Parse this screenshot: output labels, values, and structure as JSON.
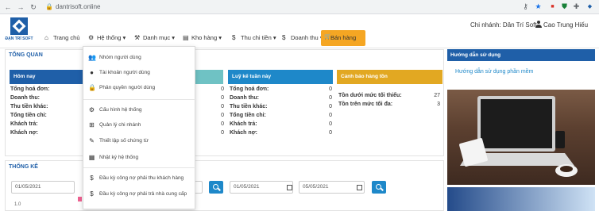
{
  "browser": {
    "url": "dantrisoft.online"
  },
  "logo": {
    "text": "ĐẠN TRÍ SOFT"
  },
  "header": {
    "branch_label": "Chi nhánh: Dân Trí Soft",
    "user_name": "Cao Trung Hiếu"
  },
  "menu": [
    {
      "label": "Trang chủ",
      "icon": "home-icon"
    },
    {
      "label": "Hệ thống",
      "icon": "gear-icon"
    },
    {
      "label": "Danh mục",
      "icon": "wrench-icon"
    },
    {
      "label": "Kho hàng",
      "icon": "warehouse-icon"
    },
    {
      "label": "Thu chi tiền",
      "icon": "dollar-icon"
    },
    {
      "label": "Doanh thu",
      "icon": "dollar-icon"
    },
    {
      "label": "Bán hàng",
      "icon": "cart-icon"
    }
  ],
  "overview": {
    "title": "TỔNG QUAN"
  },
  "cards": {
    "today": {
      "title": "Hôm nay",
      "rows": [
        "Tổng hoá đơn:",
        "Doanh thu:",
        "Thu tiền khác:",
        "Tổng tiền chi:",
        "Khách trả:",
        "Khách nợ:"
      ]
    },
    "middle": {
      "values": [
        "0",
        "0",
        "0",
        "0",
        "0",
        "0"
      ]
    },
    "weekly": {
      "title": "Luỹ kế tuần này",
      "rows": [
        "Tổng hoá đơn:",
        "Doanh thu:",
        "Thu tiền khác:",
        "Tổng tiền chi:",
        "Khách trả:",
        "Khách nợ:"
      ],
      "values": [
        "0",
        "0",
        "0",
        "0",
        "0",
        "0"
      ]
    },
    "stock": {
      "title": "Cảnh báo hàng tồn",
      "rows": [
        "Tồn dưới mức tối thiểu:",
        "Tồn trên mức tối đa:"
      ],
      "values": [
        "27",
        "3"
      ]
    }
  },
  "stats": {
    "title": "THỐNG KÊ",
    "date_from_1": "01/05/2021",
    "date_from_2": "01/05/2021",
    "date_to_2": "05/05/2021",
    "axis_value": "1.0"
  },
  "dropdown": {
    "items": [
      {
        "label": "Nhóm người dùng",
        "icon": "users-icon"
      },
      {
        "label": "Tài khoản người dùng",
        "icon": "user-icon"
      },
      {
        "label": "Phân quyền người dùng",
        "icon": "lock-icon"
      },
      {
        "label": "Cấu hình hệ thống",
        "icon": "cogs-icon"
      },
      {
        "label": "Quản lý chi nhánh",
        "icon": "sitemap-icon"
      },
      {
        "label": "Thiết lập số chứng từ",
        "icon": "edit-icon"
      },
      {
        "label": "Nhật ký hệ thống",
        "icon": "calendar-icon"
      },
      {
        "label": "Đầu kỳ công nợ phải thu khách hàng",
        "icon": "dollar-icon"
      },
      {
        "label": "Đầu kỳ công nợ phải trả nhà cung cấp",
        "icon": "dollar-icon"
      }
    ]
  },
  "guide": {
    "title": "Hướng dẫn sử dụng",
    "link": "Hướng dẫn sử dụng phần mềm"
  },
  "colors": {
    "brand": "#1f5fa8",
    "teal": "#6fc2c4",
    "blue": "#1e88c9",
    "amber": "#e2a822",
    "accent_button": "#f5a623"
  }
}
